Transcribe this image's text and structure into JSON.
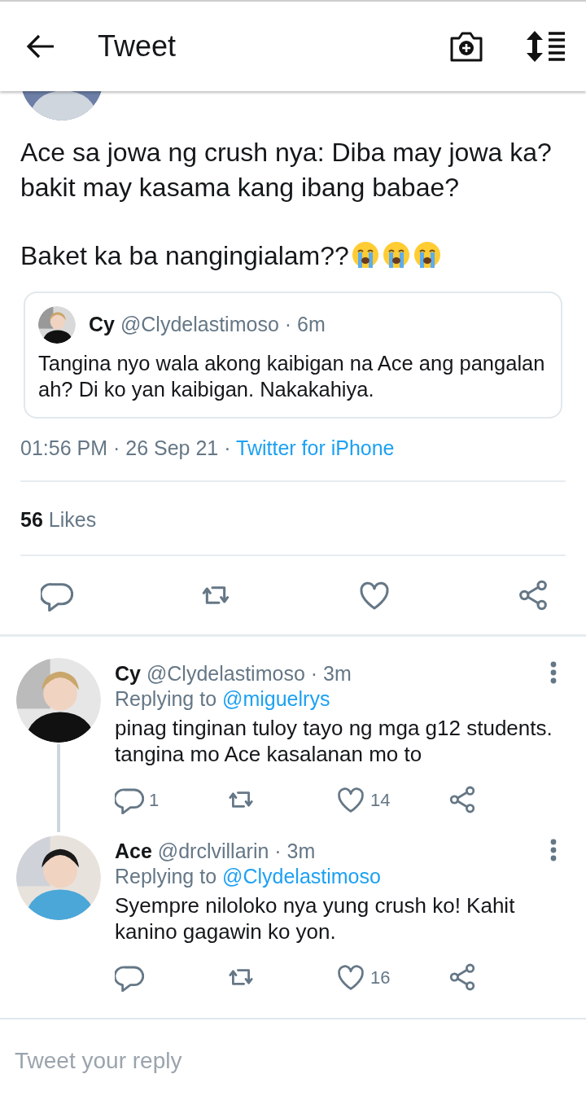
{
  "header": {
    "title": "Tweet"
  },
  "tweet": {
    "paragraphs": [
      {
        "text": "Ace sa jowa ng crush nya: Diba may jowa ka? bakit may kasama kang ibang babae?"
      },
      {
        "text": "Baket ka ba nangingialam??",
        "emojis": [
          {
            "kind": "crying"
          },
          {
            "kind": "crying"
          },
          {
            "kind": "crying"
          }
        ]
      }
    ],
    "quote": {
      "name": "Cy",
      "meta": "@Clydelastimoso · 6m",
      "text": "Tangina nyo wala akong kaibigan na Ace ang pangalan ah? Di ko yan kaibigan. Nakakahiya."
    },
    "timestamp": "01:56 PM · 26 Sep 21 ·",
    "source": "Twitter for iPhone",
    "likes": {
      "count": "56",
      "label": "Likes"
    }
  },
  "replies": [
    {
      "name": "Cy",
      "meta": "@Clydelastimoso · 3m",
      "replying_label": "Replying to",
      "replying_handle": "@miguelrys",
      "text": "pinag tinginan tuloy tayo ng mga g12 students. tangina mo Ace kasalanan mo to",
      "reply_count": "1",
      "like_count": "14",
      "thread_continues": true
    },
    {
      "name": "Ace",
      "meta": "@drclvillarin · 3m",
      "replying_label": "Replying to",
      "replying_handle": "@Clydelastimoso",
      "text": "Syempre niloloko nya yung crush ko! Kahit kanino gagawin ko yon.",
      "like_count": "16",
      "thread_continues": false
    }
  ],
  "reply_box": {
    "placeholder": "Tweet your reply"
  }
}
